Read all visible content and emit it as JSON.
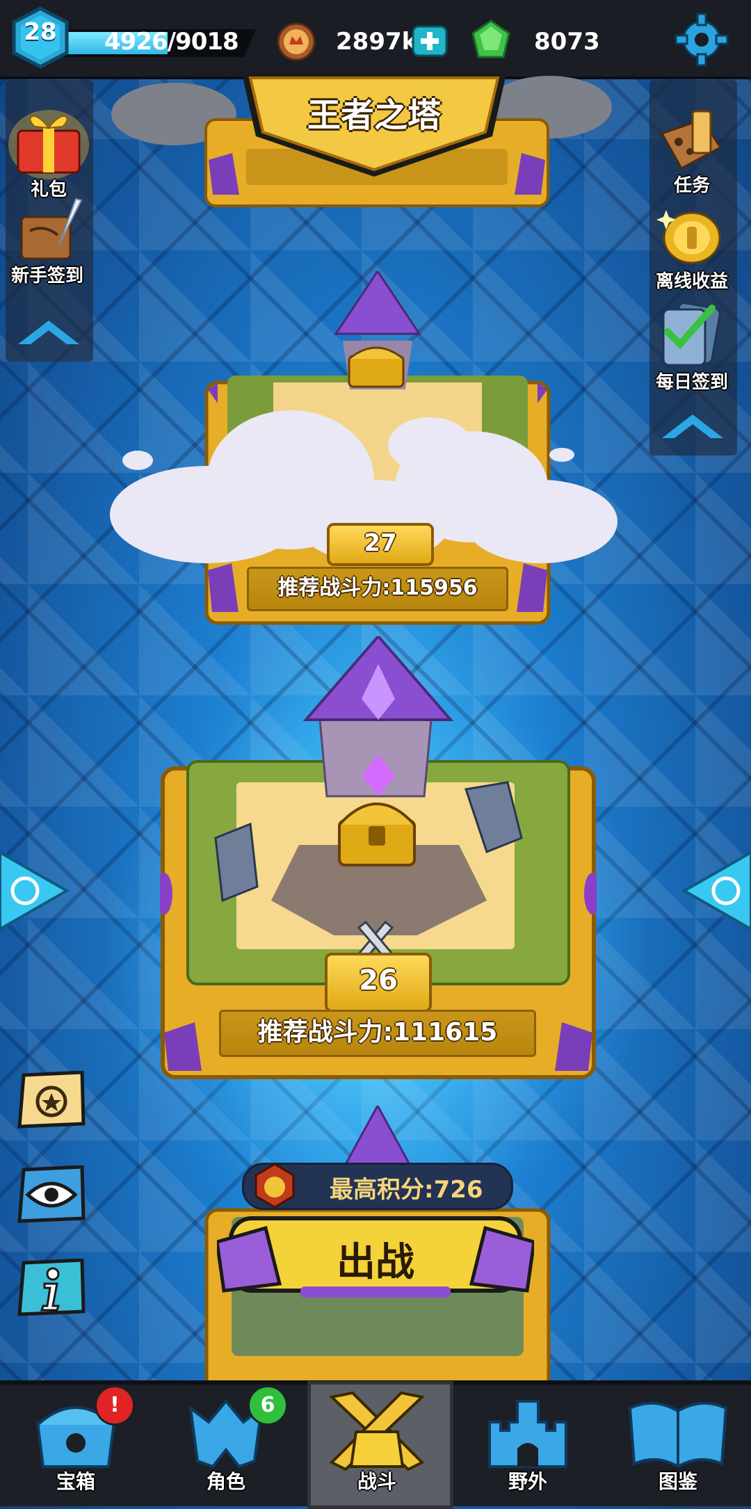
{
  "player": {
    "level": "28",
    "xp_text": "4926/9018",
    "xp_fraction": 0.546
  },
  "currency": {
    "coins": "2897k",
    "gems": "8073"
  },
  "tower": {
    "title": "王者之塔"
  },
  "left_menu": [
    {
      "label": "礼包",
      "icon": "gift-box-icon"
    },
    {
      "label": "新手签到",
      "icon": "scroll-quill-icon"
    }
  ],
  "right_menu": [
    {
      "label": "任务",
      "icon": "quest-map-icon"
    },
    {
      "label": "离线收益",
      "icon": "gold-coin-icon"
    },
    {
      "label": "每日签到",
      "icon": "checkmark-card-icon"
    }
  ],
  "stages": [
    {
      "stage": "26",
      "power_text": "推荐战斗力:111615"
    },
    {
      "stage": "27",
      "power_text": "推荐战斗力:115956"
    }
  ],
  "best_score_text": "最高积分:726",
  "battle_label": "出战",
  "nav": [
    {
      "label": "宝箱",
      "icon": "treasure-chest-icon",
      "badge": "!"
    },
    {
      "label": "角色",
      "icon": "helmet-icon",
      "badge": "6"
    },
    {
      "label": "战斗",
      "icon": "crossed-swords-icon",
      "active": true
    },
    {
      "label": "野外",
      "icon": "castle-icon"
    },
    {
      "label": "图鉴",
      "icon": "book-icon"
    }
  ],
  "colors": {
    "accent": "#2fb7e6",
    "gold": "#e9b624",
    "gem": "#55d65a",
    "purple": "#8a4fd0"
  }
}
